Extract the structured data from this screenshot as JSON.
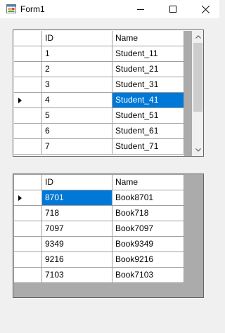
{
  "window": {
    "title": "Form1"
  },
  "top_grid": {
    "columns": [
      "ID",
      "Name"
    ],
    "rows": [
      {
        "id": "1",
        "name": "Student_11"
      },
      {
        "id": "2",
        "name": "Student_21"
      },
      {
        "id": "3",
        "name": "Student_31"
      },
      {
        "id": "4",
        "name": "Student_41",
        "selected": true
      },
      {
        "id": "5",
        "name": "Student_51"
      },
      {
        "id": "6",
        "name": "Student_61"
      },
      {
        "id": "7",
        "name": "Student_71"
      }
    ],
    "current_row": 3
  },
  "bottom_grid": {
    "columns": [
      "ID",
      "Name"
    ],
    "rows": [
      {
        "id": "8701",
        "name": "Book8701",
        "selected": true
      },
      {
        "id": "718",
        "name": "Book718"
      },
      {
        "id": "7097",
        "name": "Book7097"
      },
      {
        "id": "9349",
        "name": "Book9349"
      },
      {
        "id": "9216",
        "name": "Book9216"
      },
      {
        "id": "7103",
        "name": "Book7103"
      }
    ],
    "current_row": 0
  },
  "icons": {
    "app": "form-app-icon",
    "minimize": "minimize-icon",
    "maximize": "maximize-icon",
    "close": "close-icon",
    "scroll_up": "chevron-up-icon",
    "scroll_down": "chevron-down-icon",
    "row_pointer": "current-row-arrow-icon"
  },
  "colors": {
    "selection": "#0078d7",
    "grid_background": "#ababab",
    "gridline": "#a0a0a0"
  }
}
